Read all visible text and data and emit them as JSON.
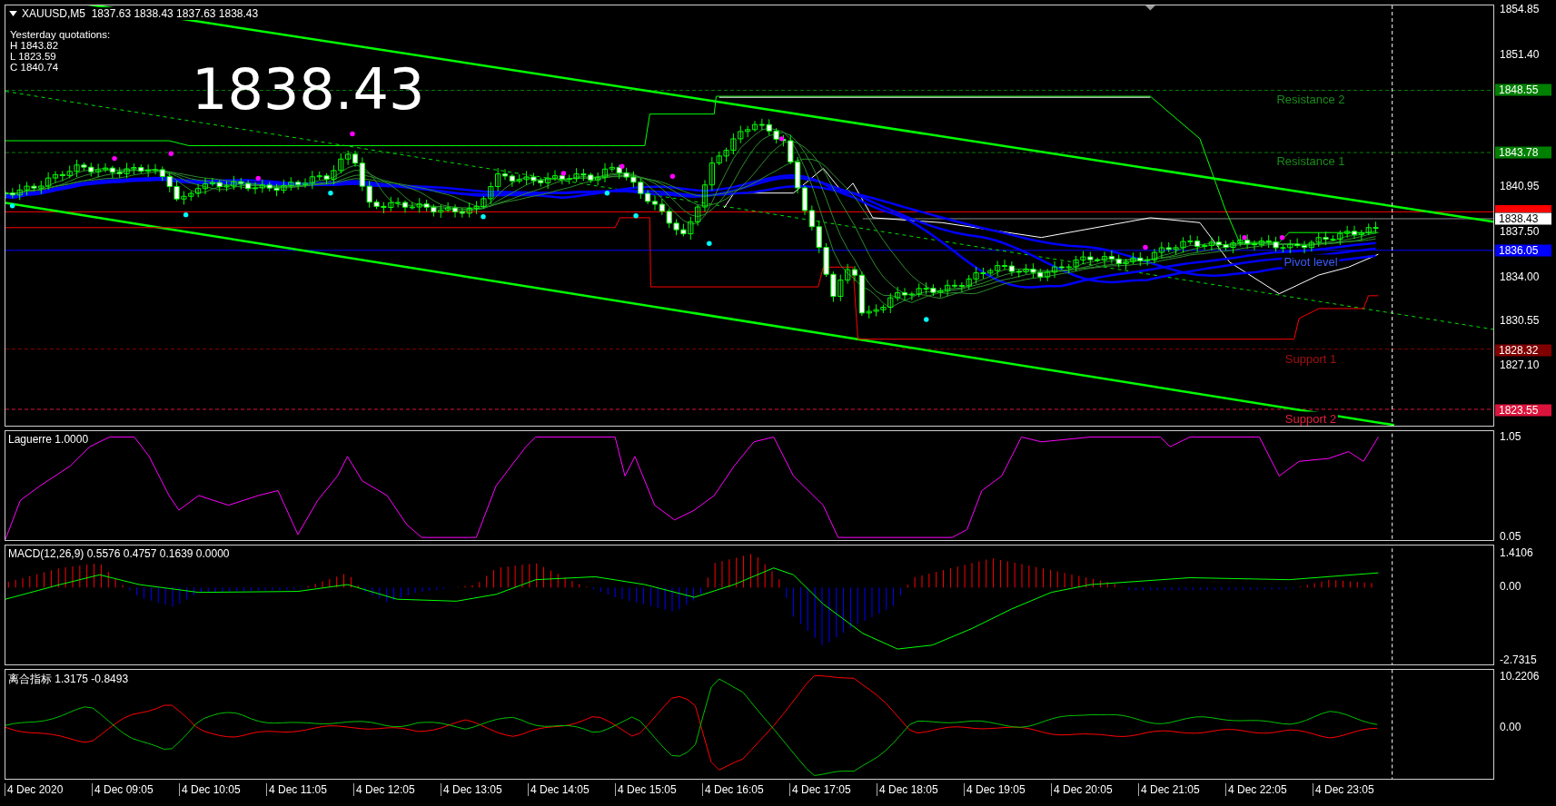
{
  "chart": {
    "symbol_line": "XAUUSD,M5  1837.63 1838.43 1837.63 1838.43",
    "yesterday_title": "Yesterday quotations:",
    "yesterday": [
      "H 1843.82",
      "L 1823.59",
      "C 1840.74"
    ],
    "last_price": "1838.43",
    "levels": [
      {
        "label": "Resistance 2",
        "price": "1848.55",
        "color": "#008000"
      },
      {
        "label": "Resistance 1",
        "price": "1843.78",
        "color": "#008000"
      },
      {
        "label": "Pivot level",
        "price": "1836.05",
        "color": "#0000ff"
      },
      {
        "label": "Support 1",
        "price": "1828.32",
        "color": "#800000"
      },
      {
        "label": "Support 2",
        "price": "1823.55",
        "color": "#dc143c"
      }
    ],
    "current_price": "1838.43",
    "price_axis": [
      "1854.85",
      "1851.40",
      "1840.95",
      "1837.50",
      "1834.00",
      "1830.55",
      "1827.10"
    ]
  },
  "indicators": [
    {
      "kind": "laguerre",
      "title": "Laguerre 1.0000",
      "axis": [
        "1.05",
        "0.05"
      ]
    },
    {
      "kind": "macd",
      "title": "MACD(12,26,9) 0.5576 0.4757 0.1639 0.0000",
      "axis": [
        "1.4106",
        "0.00",
        "-2.7315"
      ]
    },
    {
      "kind": "lihe",
      "title": "离合指标 1.3175 -0.8493",
      "axis": [
        "10.2206",
        "0.00"
      ]
    }
  ],
  "time_axis": [
    "4 Dec 2020",
    "4 Dec 09:05",
    "4 Dec 10:05",
    "4 Dec 11:05",
    "4 Dec 12:05",
    "4 Dec 13:05",
    "4 Dec 14:05",
    "4 Dec 15:05",
    "4 Dec 16:05",
    "4 Dec 17:05",
    "4 Dec 18:05",
    "4 Dec 19:05",
    "4 Dec 20:05",
    "4 Dec 21:05",
    "4 Dec 22:05",
    "4 Dec 23:05"
  ]
}
